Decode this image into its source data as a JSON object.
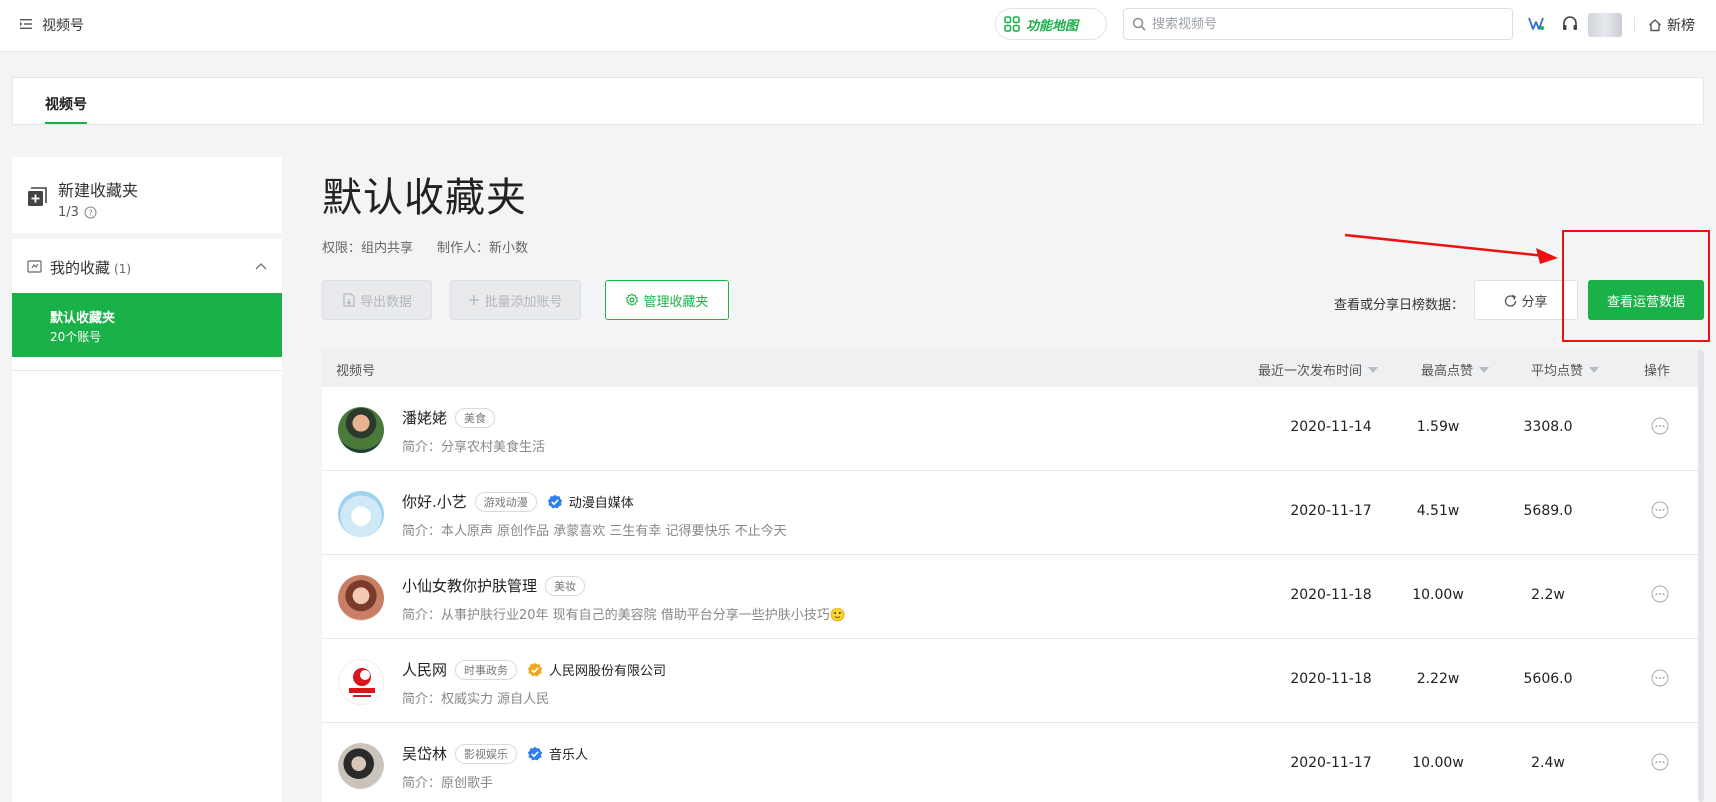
{
  "topbar": {
    "app_title": "视频号",
    "feature_map_label": "功能地图",
    "search_placeholder": "搜索视频号",
    "home_label": "新榜"
  },
  "tab": {
    "label": "视频号"
  },
  "sidebar": {
    "new_folder_label": "新建收藏夹",
    "new_folder_count": "1/3",
    "favorites_label": "我的收藏",
    "favorites_count": "(1)",
    "active_folder": {
      "name": "默认收藏夹",
      "sub": "20个账号"
    }
  },
  "main": {
    "title": "默认收藏夹",
    "permission": "权限：组内共享",
    "creator": "制作人：新小数",
    "buttons": {
      "export": "导出数据",
      "batch_add": "批量添加账号",
      "manage": "管理收藏夹",
      "share": "分享",
      "view_ops": "查看运营数据"
    },
    "share_label": "查看或分享日榜数据："
  },
  "table": {
    "headers": {
      "account": "视频号",
      "last_publish": "最近一次发布时间",
      "max_likes": "最高点赞",
      "avg_likes": "平均点赞",
      "actions": "操作"
    },
    "rows": [
      {
        "name": "潘姥姥",
        "tag": "美食",
        "verified": "",
        "bio": "简介：分享农村美食生活",
        "date": "2020-11-14",
        "max": "1.59w",
        "avg": "3308.0"
      },
      {
        "name": "你好.小艺",
        "tag": "游戏动漫",
        "verified": "动漫自媒体",
        "bio": "简介：本人原声 原创作品 承蒙喜欢 三生有幸 记得要快乐 不止今天",
        "date": "2020-11-17",
        "max": "4.51w",
        "avg": "5689.0"
      },
      {
        "name": "小仙女教你护肤管理",
        "tag": "美妆",
        "verified": "",
        "bio": "简介：从事护肤行业20年 现有自己的美容院 借助平台分享一些护肤小技巧🙂",
        "date": "2020-11-18",
        "max": "10.00w",
        "avg": "2.2w"
      },
      {
        "name": "人民网",
        "tag": "时事政务",
        "verified": "人民网股份有限公司",
        "bio": "简介：权威实力 源自人民",
        "date": "2020-11-18",
        "max": "2.22w",
        "avg": "5606.0"
      },
      {
        "name": "吴岱林",
        "tag": "影视娱乐",
        "verified": "音乐人",
        "bio": "简介：原创歌手",
        "date": "2020-11-17",
        "max": "10.00w",
        "avg": "2.4w"
      }
    ]
  },
  "colors": {
    "brand_green": "#1ab248",
    "annotation_red": "#f01010",
    "verified_blue": "#2f7ff0",
    "verified_gold": "#f0a61a"
  }
}
